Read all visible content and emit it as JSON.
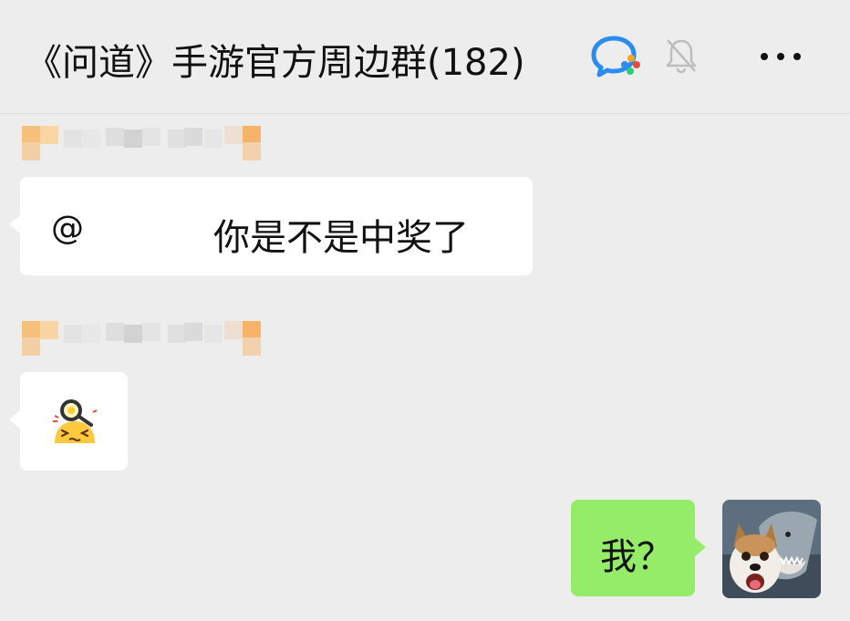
{
  "header": {
    "title": "《问道》手游官方周边群(182)",
    "wecom_icon": "wecom-chat-icon",
    "mute_icon": "bell-off-icon",
    "more_icon": "more-dots-icon"
  },
  "messages": [
    {
      "side": "left",
      "sender_name": "",
      "mention": "@",
      "text": "你是不是中奖了"
    },
    {
      "side": "left",
      "sender_name": "",
      "sticker": "frying-pan-face-emoji"
    },
    {
      "side": "right",
      "text": "我？",
      "avatar": "dog-shark-avatar"
    }
  ],
  "colors": {
    "background": "#ededed",
    "incoming_bubble": "#ffffff",
    "outgoing_bubble": "#95ec69",
    "text": "#111111"
  }
}
